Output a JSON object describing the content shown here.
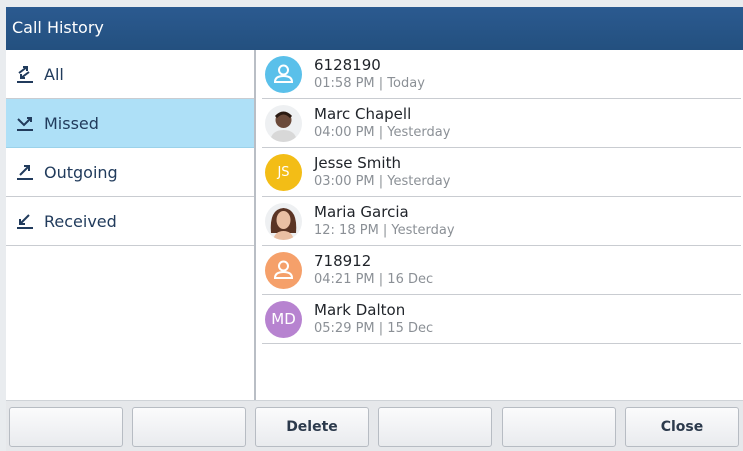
{
  "window": {
    "title": "Call History"
  },
  "filters": [
    {
      "label": "All",
      "icon": "all-calls-icon",
      "selected": false
    },
    {
      "label": "Missed",
      "icon": "missed-call-icon",
      "selected": true
    },
    {
      "label": "Outgoing",
      "icon": "outgoing-call-icon",
      "selected": false
    },
    {
      "label": "Received",
      "icon": "received-call-icon",
      "selected": false
    }
  ],
  "calls": [
    {
      "name": "6128190",
      "time": "01:58 PM | Today",
      "avatar": {
        "type": "contact-icon",
        "color": "#5ac0ea"
      }
    },
    {
      "name": "Marc Chapell",
      "time": "04:00 PM | Yesterday",
      "avatar": {
        "type": "photo",
        "color": "#6b4a3a"
      }
    },
    {
      "name": "Jesse Smith",
      "time": "03:00 PM | Yesterday",
      "avatar": {
        "type": "initials",
        "initials": "JS",
        "color": "#f3bd16"
      }
    },
    {
      "name": "Maria Garcia",
      "time": "12: 18 PM | Yesterday",
      "avatar": {
        "type": "photo",
        "color": "#5a3424"
      }
    },
    {
      "name": "718912",
      "time": "04:21 PM | 16 Dec",
      "avatar": {
        "type": "contact-icon",
        "color": "#f5a06a"
      }
    },
    {
      "name": "Mark Dalton",
      "time": "05:29 PM | 15 Dec",
      "avatar": {
        "type": "initials",
        "initials": "MD",
        "color": "#b783d0"
      }
    }
  ],
  "softkeys": [
    "",
    "",
    "Delete",
    "",
    "",
    "Close"
  ],
  "colors": {
    "titlebar": "#23507f",
    "selected": "#aee0f7",
    "accent": "#213b5c"
  }
}
